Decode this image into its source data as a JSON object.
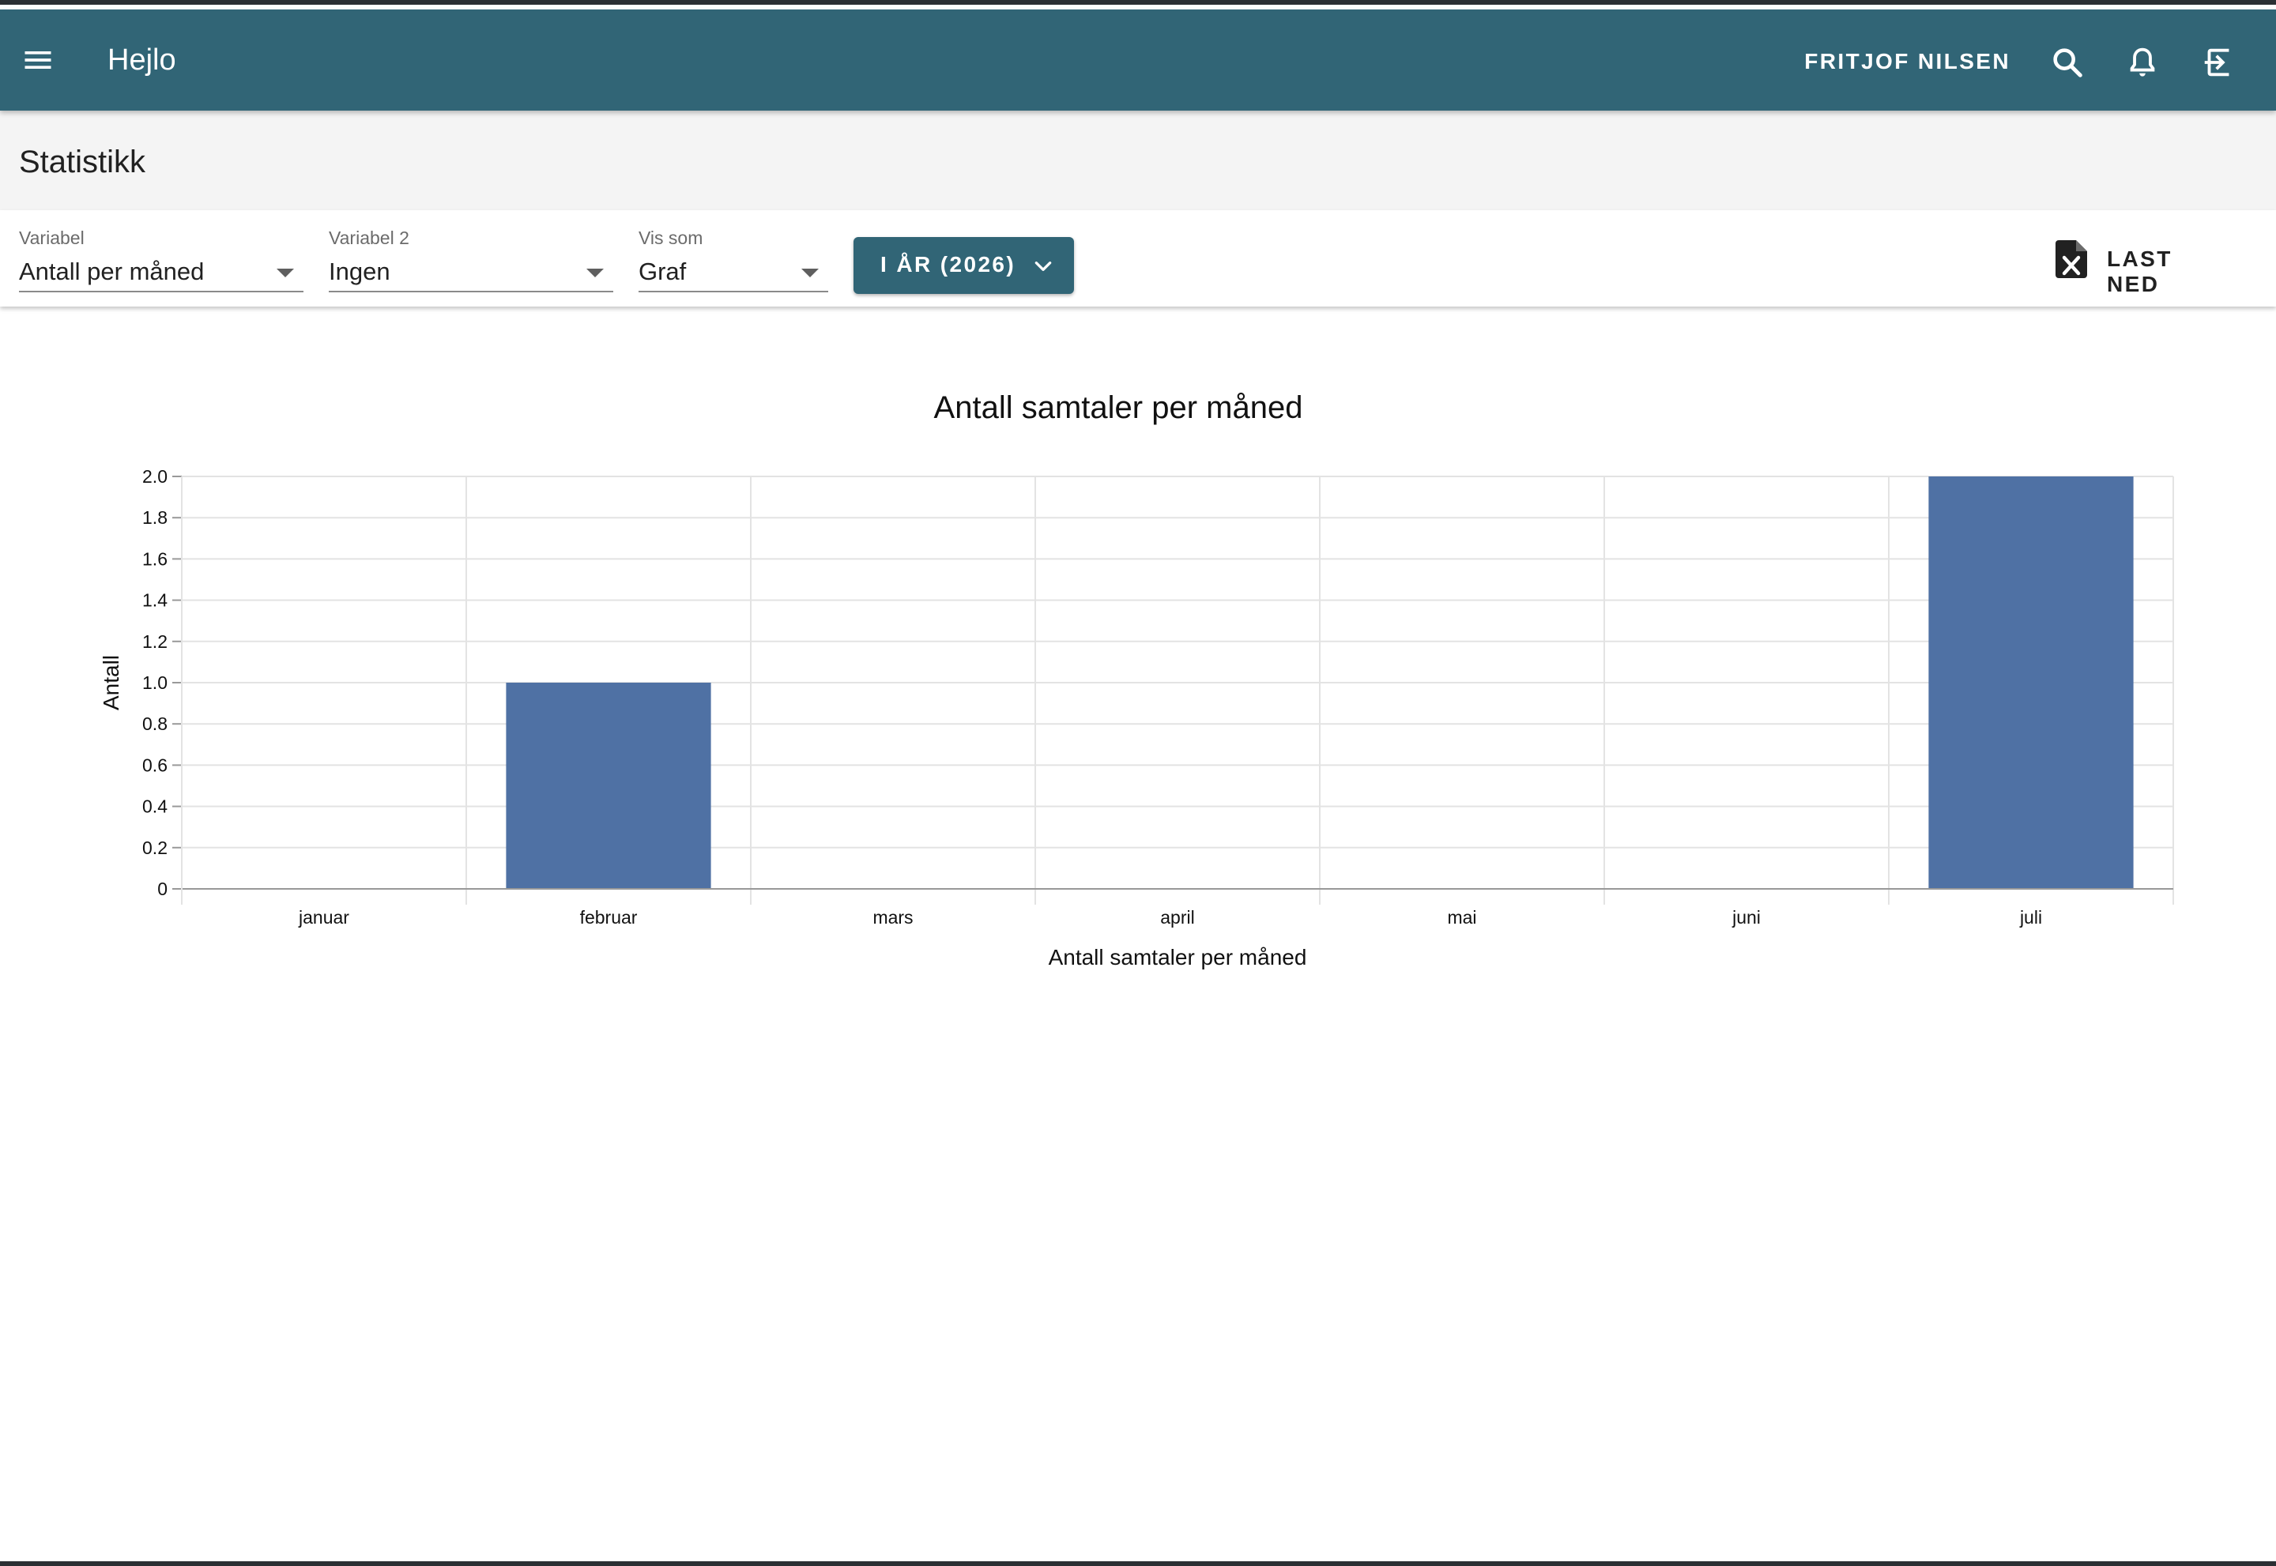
{
  "app": {
    "title": "Hejlo",
    "user_name": "FRITJOF NILSEN"
  },
  "page": {
    "title": "Statistikk"
  },
  "filters": {
    "variable": {
      "label": "Variabel",
      "value": "Antall per måned"
    },
    "variable2": {
      "label": "Variabel 2",
      "value": "Ingen"
    },
    "display": {
      "label": "Vis som",
      "value": "Graf"
    },
    "period_button": "I ÅR (2026)",
    "download_label": "LAST NED"
  },
  "icons": {
    "menu": "menu-icon",
    "search": "search-icon",
    "notifications": "bell-icon",
    "logout": "logout-icon",
    "chevron": "chevron-down-icon",
    "download": "excel-file-icon"
  },
  "colors": {
    "appbar": "#316576",
    "bar": "#4f71a4",
    "grid": "#e3e3e3",
    "axis": "#999999"
  },
  "chart_data": {
    "type": "bar",
    "title": "Antall samtaler per måned",
    "xlabel": "Antall samtaler per måned",
    "ylabel": "Antall",
    "categories": [
      "januar",
      "februar",
      "mars",
      "april",
      "mai",
      "juni",
      "juli"
    ],
    "values": [
      0,
      1,
      0,
      0,
      0,
      0,
      2
    ],
    "ylim": [
      0,
      2
    ],
    "yticks": [
      "0",
      "0.2",
      "0.4",
      "0.6",
      "0.8",
      "1.0",
      "1.2",
      "1.4",
      "1.6",
      "1.8",
      "2.0"
    ],
    "grid": true,
    "legend": "none"
  }
}
